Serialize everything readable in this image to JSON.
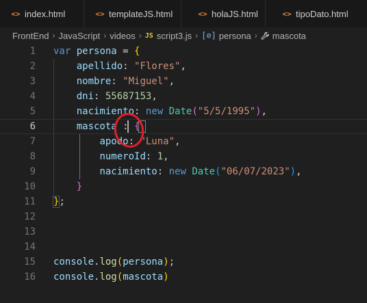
{
  "tabs": [
    {
      "label": "index.html",
      "icon": "html-file-icon"
    },
    {
      "label": "templateJS.html",
      "icon": "html-file-icon"
    },
    {
      "label": "holaJS.html",
      "icon": "html-file-icon"
    },
    {
      "label": "tipoDato.html",
      "icon": "html-file-icon"
    }
  ],
  "breadcrumb": {
    "items": [
      "FrontEnd",
      "JavaScript",
      "videos",
      "script3.js",
      "persona",
      "mascota"
    ],
    "file_badge": "JS",
    "object_badge": "[⊘]"
  },
  "editor": {
    "line_numbers": [
      "1",
      "2",
      "3",
      "4",
      "5",
      "6",
      "7",
      "8",
      "9",
      "10",
      "11",
      "12",
      "13",
      "14",
      "15",
      "16"
    ],
    "active_line": "6",
    "tokens": {
      "var_kw": "var",
      "persona": "persona",
      "eq": " = ",
      "open_brace": "{",
      "apellido_key": "apellido",
      "colon": ": ",
      "apellido_val": "\"Flores\"",
      "nombre_key": "nombre",
      "nombre_val": "\"Miguel\"",
      "dni_key": "dni",
      "dni_val": "55687153",
      "nacimiento_key": "nacimiento",
      "new_kw": "new",
      "date_cls": "Date",
      "open_paren": "(",
      "close_paren": ")",
      "nacimiento_val": "\"5/5/1995\"",
      "mascota_key": "mascota",
      "apodo_key": "apodo",
      "apodo_val": "\"Luna\"",
      "numeroId_key": "numeroId",
      "numeroId_val": "1",
      "nac2_val": "\"06/07/2023\"",
      "close_brace": "}",
      "close_stmt": "};",
      "comma": ",",
      "console": "console",
      "dot": ".",
      "log": "log",
      "mascota_ident": "mascota",
      "stmt_end": ";"
    }
  },
  "colors": {
    "background": "#1f1f1f",
    "keyword": "#569cd6",
    "variable": "#9cdcfe",
    "string": "#ce9178",
    "number": "#b5cea8",
    "class": "#4ec9b0",
    "function": "#dcdcaa",
    "bracket_gold": "#ffd700",
    "bracket_purple": "#da70d6",
    "annotation_circle": "#e3202a"
  }
}
